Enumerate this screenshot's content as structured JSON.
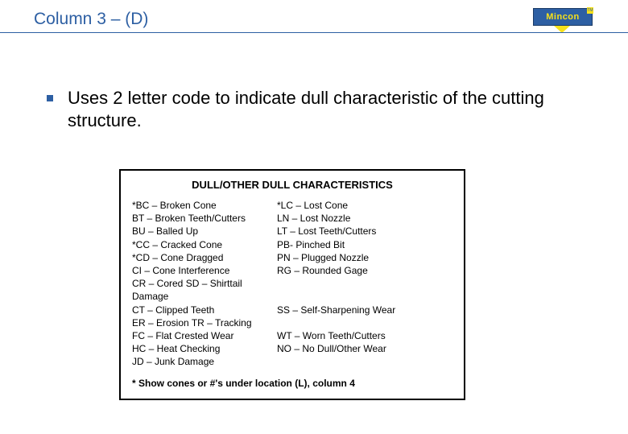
{
  "title": "Column 3 – (D)",
  "logo": {
    "text": "Mincon",
    "tm": "TM"
  },
  "bullet": "Uses 2 letter code to indicate dull characteristic of the cutting structure.",
  "table": {
    "heading": "DULL/OTHER DULL CHARACTERISTICS",
    "rows": [
      {
        "c1": "*BC – Broken Cone",
        "c2": "*LC – Lost Cone"
      },
      {
        "c1": "BT – Broken Teeth/Cutters",
        "c2": "LN – Lost Nozzle"
      },
      {
        "c1": "BU – Balled Up",
        "c2": "LT – Lost Teeth/Cutters"
      },
      {
        "c1": "*CC – Cracked Cone",
        "c2": "PB- Pinched Bit"
      },
      {
        "c1": "*CD – Cone Dragged",
        "c2": "PN – Plugged Nozzle"
      },
      {
        "c1": "CI – Cone Interference",
        "c2": "RG – Rounded Gage"
      },
      {
        "c1": "CR – Cored   SD – Shirttail Damage",
        "c2": ""
      },
      {
        "c1": "CT – Clipped Teeth",
        "c2": "SS – Self-Sharpening Wear"
      },
      {
        "c1": "ER – Erosion TR – Tracking",
        "c2": ""
      },
      {
        "c1": "FC – Flat Crested Wear",
        "c2": "WT – Worn Teeth/Cutters"
      },
      {
        "c1": "HC – Heat Checking",
        "c2": "NO – No Dull/Other Wear"
      },
      {
        "c1": "JD – Junk Damage",
        "c2": ""
      }
    ],
    "footnote": "* Show cones or #'s under location (L), column 4"
  }
}
